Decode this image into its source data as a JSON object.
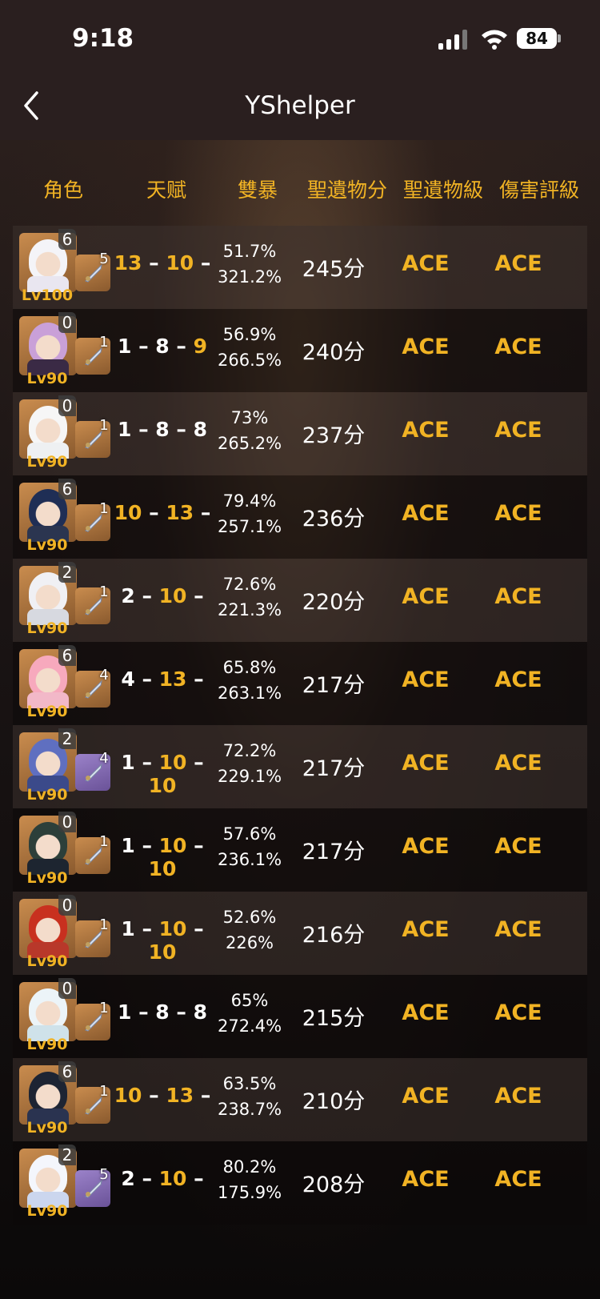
{
  "status": {
    "time": "9:18",
    "battery": "84"
  },
  "nav": {
    "title": "YShelper"
  },
  "headers": [
    "角色",
    "天赋",
    "雙暴",
    "聖遺物分",
    "聖遺物級",
    "傷害評級"
  ],
  "rows": [
    {
      "cons": "6",
      "lv": "Lv100",
      "ref": "5",
      "t": [
        {
          "v": "13",
          "y": true
        },
        {
          "v": " – "
        },
        {
          "v": "10",
          "y": true
        },
        {
          "v": " –"
        }
      ],
      "cr": "51.7%",
      "cd": "321.2%",
      "score": "245分",
      "art": "ACE",
      "dmg": "ACE",
      "weapon_color": "orange"
    },
    {
      "cons": "0",
      "lv": "Lv90",
      "ref": "1",
      "t": [
        {
          "v": "1"
        },
        {
          "v": " – "
        },
        {
          "v": "8"
        },
        {
          "v": " – "
        },
        {
          "v": "9",
          "y": true
        }
      ],
      "cr": "56.9%",
      "cd": "266.5%",
      "score": "240分",
      "art": "ACE",
      "dmg": "ACE",
      "weapon_color": "orange"
    },
    {
      "cons": "0",
      "lv": "Lv90",
      "ref": "1",
      "t": [
        {
          "v": "1"
        },
        {
          "v": " – "
        },
        {
          "v": "8"
        },
        {
          "v": " – "
        },
        {
          "v": "8"
        }
      ],
      "cr": "73%",
      "cd": "265.2%",
      "score": "237分",
      "art": "ACE",
      "dmg": "ACE",
      "weapon_color": "orange"
    },
    {
      "cons": "6",
      "lv": "Lv90",
      "ref": "1",
      "t": [
        {
          "v": "10",
          "y": true
        },
        {
          "v": " – "
        },
        {
          "v": "13",
          "y": true
        },
        {
          "v": " –"
        }
      ],
      "cr": "79.4%",
      "cd": "257.1%",
      "score": "236分",
      "art": "ACE",
      "dmg": "ACE",
      "weapon_color": "orange"
    },
    {
      "cons": "2",
      "lv": "Lv90",
      "ref": "1",
      "t": [
        {
          "v": "2"
        },
        {
          "v": " – "
        },
        {
          "v": "10",
          "y": true
        },
        {
          "v": " –"
        }
      ],
      "cr": "72.6%",
      "cd": "221.3%",
      "score": "220分",
      "art": "ACE",
      "dmg": "ACE",
      "weapon_color": "orange"
    },
    {
      "cons": "6",
      "lv": "Lv90",
      "ref": "4",
      "t": [
        {
          "v": "4"
        },
        {
          "v": " – "
        },
        {
          "v": "13",
          "y": true
        },
        {
          "v": " –"
        }
      ],
      "cr": "65.8%",
      "cd": "263.1%",
      "score": "217分",
      "art": "ACE",
      "dmg": "ACE",
      "weapon_color": "orange"
    },
    {
      "cons": "2",
      "lv": "Lv90",
      "ref": "4",
      "t": [
        {
          "v": "1"
        },
        {
          "v": " – "
        },
        {
          "v": "10",
          "y": true
        },
        {
          "v": " – "
        },
        {
          "v": "10",
          "y": true
        }
      ],
      "cr": "72.2%",
      "cd": "229.1%",
      "score": "217分",
      "art": "ACE",
      "dmg": "ACE",
      "weapon_color": "purple"
    },
    {
      "cons": "0",
      "lv": "Lv90",
      "ref": "1",
      "t": [
        {
          "v": "1"
        },
        {
          "v": " – "
        },
        {
          "v": "10",
          "y": true
        },
        {
          "v": " – "
        },
        {
          "v": "10",
          "y": true
        }
      ],
      "cr": "57.6%",
      "cd": "236.1%",
      "score": "217分",
      "art": "ACE",
      "dmg": "ACE",
      "weapon_color": "orange"
    },
    {
      "cons": "0",
      "lv": "Lv90",
      "ref": "1",
      "t": [
        {
          "v": "1"
        },
        {
          "v": " – "
        },
        {
          "v": "10",
          "y": true
        },
        {
          "v": " – "
        },
        {
          "v": "10",
          "y": true
        }
      ],
      "cr": "52.6%",
      "cd": "226%",
      "score": "216分",
      "art": "ACE",
      "dmg": "ACE",
      "weapon_color": "orange"
    },
    {
      "cons": "0",
      "lv": "Lv90",
      "ref": "1",
      "t": [
        {
          "v": "1"
        },
        {
          "v": " – "
        },
        {
          "v": "8"
        },
        {
          "v": " – "
        },
        {
          "v": "8"
        }
      ],
      "cr": "65%",
      "cd": "272.4%",
      "score": "215分",
      "art": "ACE",
      "dmg": "ACE",
      "weapon_color": "orange"
    },
    {
      "cons": "6",
      "lv": "Lv90",
      "ref": "1",
      "t": [
        {
          "v": "10",
          "y": true
        },
        {
          "v": " – "
        },
        {
          "v": "13",
          "y": true
        },
        {
          "v": " –"
        }
      ],
      "cr": "63.5%",
      "cd": "238.7%",
      "score": "210分",
      "art": "ACE",
      "dmg": "ACE",
      "weapon_color": "orange"
    },
    {
      "cons": "2",
      "lv": "Lv90",
      "ref": "5",
      "t": [
        {
          "v": "2"
        },
        {
          "v": " – "
        },
        {
          "v": "10",
          "y": true
        },
        {
          "v": " –"
        }
      ],
      "cr": "80.2%",
      "cd": "175.9%",
      "score": "208分",
      "art": "ACE",
      "dmg": "ACE",
      "weapon_color": "purple"
    }
  ],
  "colors": {
    "accent": "#f1b324",
    "header_bg": "#2a1f1f"
  }
}
